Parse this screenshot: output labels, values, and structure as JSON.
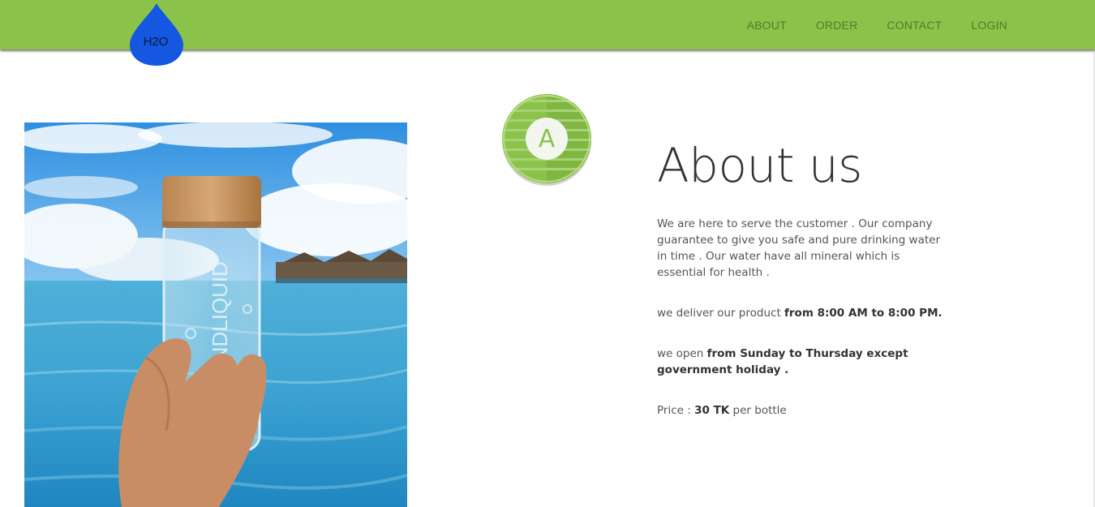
{
  "header": {
    "logo_text": "H2O",
    "nav": [
      {
        "label": "ABOUT"
      },
      {
        "label": "ORDER"
      },
      {
        "label": "CONTACT"
      },
      {
        "label": "LOGIN"
      }
    ],
    "bar_color": "#8bc34a",
    "logo_color": "#1557e0"
  },
  "badge": {
    "letter": "A",
    "color": "#8bc34a"
  },
  "about": {
    "title": "About us",
    "intro": "We are here to serve the customer . Our company guarantee to give you safe and pure drinking water in time . Our water have all mineral which is essential for health .",
    "delivery_prefix": "we deliver our product ",
    "delivery_hours": "from 8:00 AM to 8:00 PM.",
    "open_prefix": "we open ",
    "open_days": "from Sunday to Thursday except government holiday .",
    "price_prefix": "Price : ",
    "price_value": "30 TK",
    "price_suffix": " per bottle"
  },
  "photo": {
    "icon": "water-bottle-photo"
  }
}
